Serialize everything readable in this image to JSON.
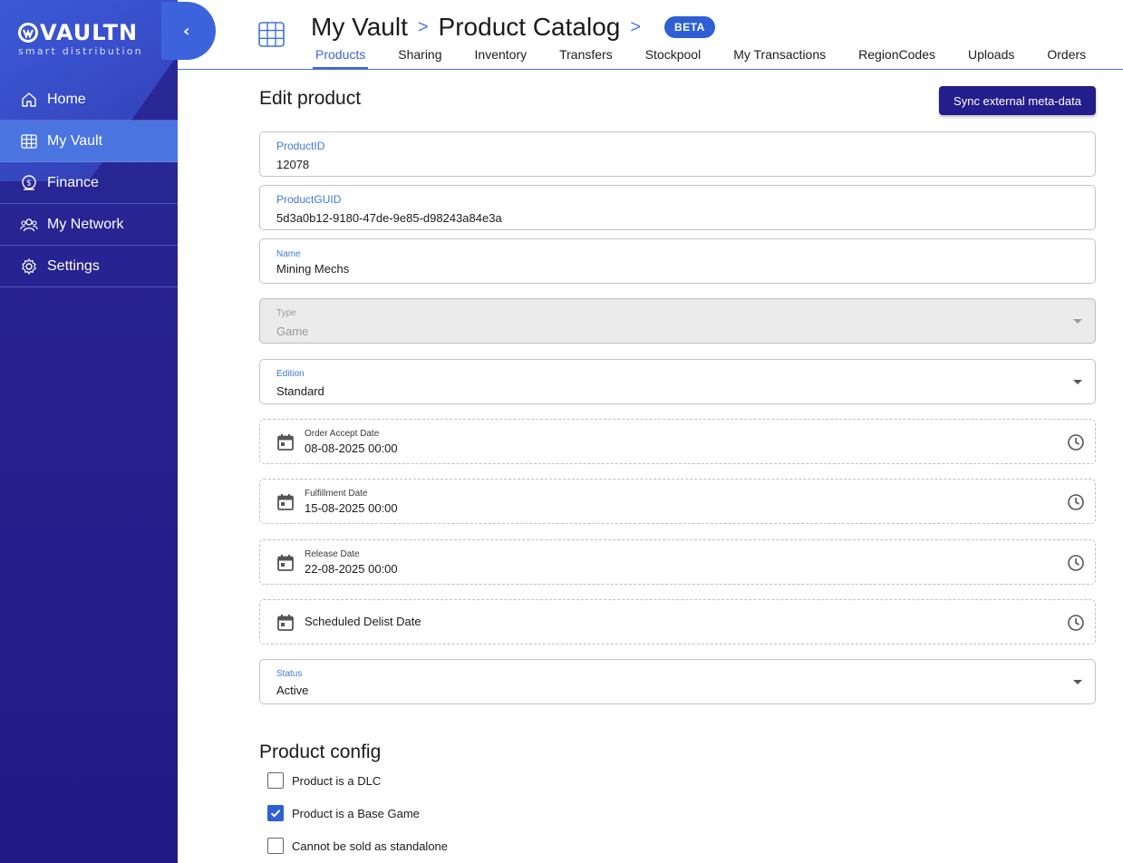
{
  "brand": {
    "name": "VAULTN",
    "tagline": "smart distribution"
  },
  "sidebar": {
    "items": [
      {
        "label": "Home",
        "icon": "home-icon"
      },
      {
        "label": "My Vault",
        "icon": "grid-icon",
        "active": true
      },
      {
        "label": "Finance",
        "icon": "dollar-coin-icon"
      },
      {
        "label": "My Network",
        "icon": "people-icon"
      },
      {
        "label": "Settings",
        "icon": "gear-icon"
      }
    ]
  },
  "header": {
    "breadcrumb": [
      "My Vault",
      "Product Catalog"
    ],
    "badge": "BETA",
    "tabs": [
      "Products",
      "Sharing",
      "Inventory",
      "Transfers",
      "Stockpool",
      "My Transactions",
      "RegionCodes",
      "Uploads",
      "Orders"
    ],
    "active_tab": "Products"
  },
  "page": {
    "title": "Edit product",
    "sync_button": "Sync external meta-data"
  },
  "form": {
    "product_id": {
      "label": "ProductID",
      "value": "12078"
    },
    "product_guid": {
      "label": "ProductGUID",
      "value": "5d3a0b12-9180-47de-9e85-d98243a84e3a"
    },
    "name": {
      "label": "Name",
      "value": "Mining Mechs"
    },
    "type": {
      "label": "Type",
      "value": "Game",
      "disabled": true
    },
    "edition": {
      "label": "Edition",
      "value": "Standard"
    },
    "order_accept_date": {
      "label": "Order Accept Date",
      "value": "08-08-2025 00:00"
    },
    "fulfillment_date": {
      "label": "Fulfillment Date",
      "value": "15-08-2025 00:00"
    },
    "release_date": {
      "label": "Release Date",
      "value": "22-08-2025 00:00"
    },
    "scheduled_delist_date": {
      "label": "Scheduled Delist Date",
      "value": ""
    },
    "status": {
      "label": "Status",
      "value": "Active"
    }
  },
  "config": {
    "title": "Product config",
    "options": [
      {
        "label": "Product is a DLC",
        "checked": false
      },
      {
        "label": "Product is a Base Game",
        "checked": true
      },
      {
        "label": "Cannot be sold as standalone",
        "checked": false
      }
    ]
  },
  "colors": {
    "sidebar_bg": "#26218f",
    "accent": "#2f5fd6",
    "active_nav": "#4a74e0",
    "button": "#241d8c"
  }
}
